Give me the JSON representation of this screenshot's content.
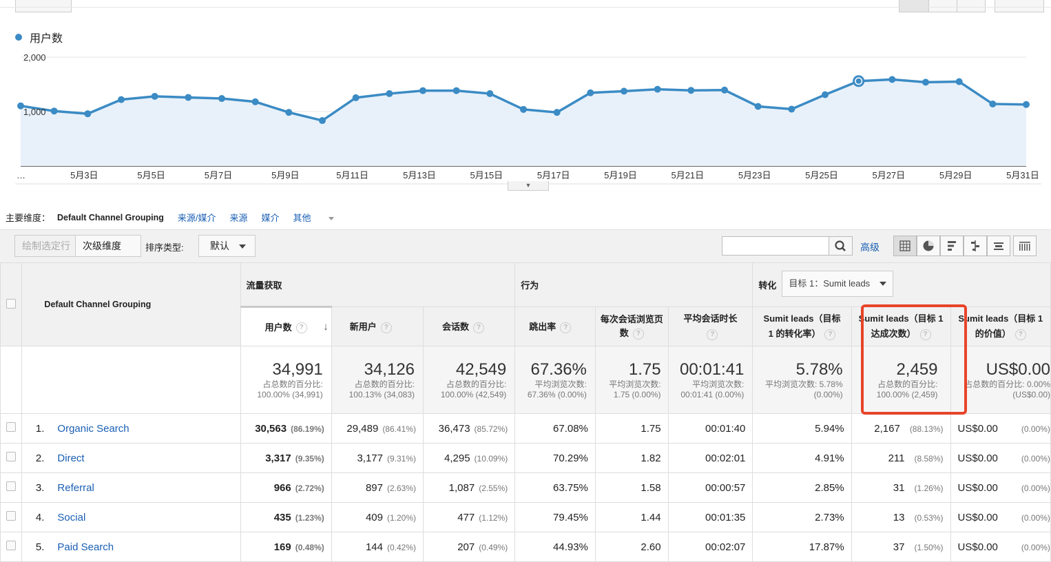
{
  "legend": {
    "metric": "用户数"
  },
  "chart_data": {
    "type": "area",
    "y_ticks": [
      "2,000",
      "1,000"
    ],
    "x_labels": [
      "…",
      "5月3日",
      "5月5日",
      "5月7日",
      "5月9日",
      "5月11日",
      "5月13日",
      "5月15日",
      "5月17日",
      "5月19日",
      "5月21日",
      "5月23日",
      "5月25日",
      "5月27日",
      "5月29日",
      "5月31日"
    ],
    "values": [
      1105,
      1010,
      960,
      1220,
      1280,
      1260,
      1240,
      1180,
      985,
      835,
      1255,
      1330,
      1385,
      1385,
      1330,
      1040,
      985,
      1345,
      1375,
      1410,
      1390,
      1395,
      1095,
      1045,
      1310,
      1560,
      1590,
      1540,
      1550,
      1140,
      1130
    ],
    "ylim": [
      0,
      2000
    ],
    "highlight_index": 25,
    "color": "#3b8bc4"
  },
  "dimensions": {
    "label": "主要维度：",
    "active": "Default Channel Grouping",
    "links": [
      "来源/媒介",
      "来源",
      "媒介",
      "其他"
    ]
  },
  "toolbar": {
    "plot_rows": "绘制选定行",
    "secondary_dimension": "次级维度",
    "sort_type_label": "排序类型:",
    "sort_value": "默认",
    "search_placeholder": "",
    "advanced": "高级"
  },
  "table": {
    "dimension_header": "Default Channel Grouping",
    "groups": {
      "acquisition": "流量获取",
      "behavior": "行为",
      "conversion": "转化",
      "goal_select": "目标 1：Sumit leads"
    },
    "columns": [
      "用户数",
      "新用户",
      "会话数",
      "跳出率",
      "每次会话浏览页数",
      "平均会话时长",
      "Sumit leads（目标 1 的转化率）",
      "Sumit leads（目标 1 达成次数）",
      "Sumit leads（目标 1 的价值）"
    ],
    "totals": [
      {
        "value": "34,991",
        "sub": "占总数的百分比: 100.00% (34,991)"
      },
      {
        "value": "34,126",
        "sub": "占总数的百分比: 100.13% (34,083)"
      },
      {
        "value": "42,549",
        "sub": "占总数的百分比: 100.00% (42,549)"
      },
      {
        "value": "67.36%",
        "sub": "平均浏览次数: 67.36% (0.00%)"
      },
      {
        "value": "1.75",
        "sub": "平均浏览次数: 1.75 (0.00%)"
      },
      {
        "value": "00:01:41",
        "sub": "平均浏览次数: 00:01:41 (0.00%)"
      },
      {
        "value": "5.78%",
        "sub": "平均浏览次数: 5.78% (0.00%)"
      },
      {
        "value": "2,459",
        "sub": "占总数的百分比: 100.00% (2,459)"
      },
      {
        "value": "US$0.00",
        "sub": "占总数的百分比: 0.00% (US$0.00)"
      }
    ],
    "rows": [
      {
        "idx": "1.",
        "name": "Organic Search",
        "users": "30,563",
        "users_pct": "(86.19%)",
        "new": "29,489",
        "new_pct": "(86.41%)",
        "sessions": "36,473",
        "sessions_pct": "(85.72%)",
        "bounce": "67.08%",
        "pages": "1.75",
        "duration": "00:01:40",
        "conv_rate": "5.94%",
        "completions": "2,167",
        "completions_pct": "(88.13%)",
        "value": "US$0.00",
        "value_pct": "(0.00%)"
      },
      {
        "idx": "2.",
        "name": "Direct",
        "users": "3,317",
        "users_pct": "(9.35%)",
        "new": "3,177",
        "new_pct": "(9.31%)",
        "sessions": "4,295",
        "sessions_pct": "(10.09%)",
        "bounce": "70.29%",
        "pages": "1.82",
        "duration": "00:02:01",
        "conv_rate": "4.91%",
        "completions": "211",
        "completions_pct": "(8.58%)",
        "value": "US$0.00",
        "value_pct": "(0.00%)"
      },
      {
        "idx": "3.",
        "name": "Referral",
        "users": "966",
        "users_pct": "(2.72%)",
        "new": "897",
        "new_pct": "(2.63%)",
        "sessions": "1,087",
        "sessions_pct": "(2.55%)",
        "bounce": "63.75%",
        "pages": "1.58",
        "duration": "00:00:57",
        "conv_rate": "2.85%",
        "completions": "31",
        "completions_pct": "(1.26%)",
        "value": "US$0.00",
        "value_pct": "(0.00%)"
      },
      {
        "idx": "4.",
        "name": "Social",
        "users": "435",
        "users_pct": "(1.23%)",
        "new": "409",
        "new_pct": "(1.20%)",
        "sessions": "477",
        "sessions_pct": "(1.12%)",
        "bounce": "79.45%",
        "pages": "1.44",
        "duration": "00:01:35",
        "conv_rate": "2.73%",
        "completions": "13",
        "completions_pct": "(0.53%)",
        "value": "US$0.00",
        "value_pct": "(0.00%)"
      },
      {
        "idx": "5.",
        "name": "Paid Search",
        "users": "169",
        "users_pct": "(0.48%)",
        "new": "144",
        "new_pct": "(0.42%)",
        "sessions": "207",
        "sessions_pct": "(0.49%)",
        "bounce": "44.93%",
        "pages": "2.60",
        "duration": "00:02:07",
        "conv_rate": "17.87%",
        "completions": "37",
        "completions_pct": "(1.50%)",
        "value": "US$0.00",
        "value_pct": "(0.00%)"
      }
    ]
  },
  "colors": {
    "accent": "#3b8bc4",
    "link": "#1a5fb4",
    "highlight": "#e8442a"
  }
}
